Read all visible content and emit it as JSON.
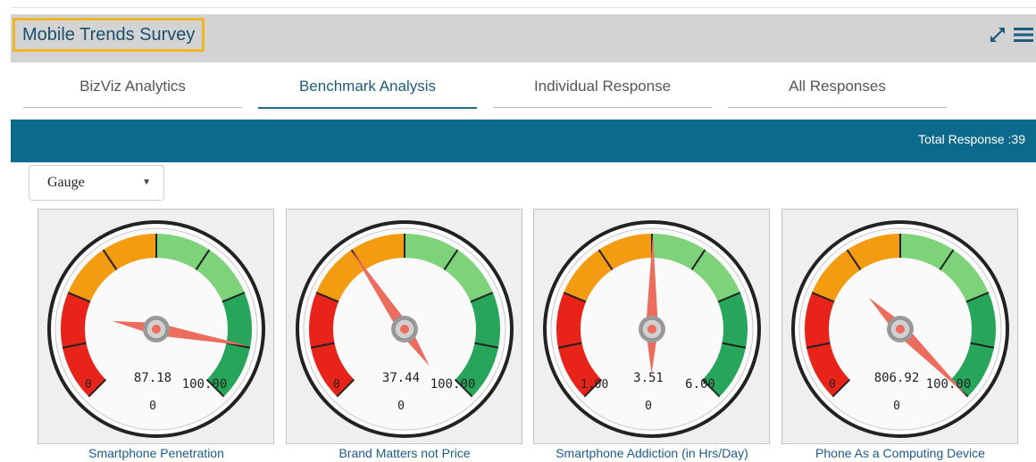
{
  "header": {
    "title": "Mobile Trends Survey",
    "expand_icon": "expand-arrows-icon",
    "menu_icon": "hamburger-menu-icon"
  },
  "tabs": [
    {
      "label": "BizViz Analytics",
      "active": false
    },
    {
      "label": "Benchmark Analysis",
      "active": true
    },
    {
      "label": "Individual Response",
      "active": false
    },
    {
      "label": "All Responses",
      "active": false
    }
  ],
  "banner": {
    "total_response": "Total Response :39"
  },
  "chart_type_select": {
    "value": "Gauge"
  },
  "colors": {
    "header_bg": "#d3d3d3",
    "title_border": "#f0b429",
    "banner_bg": "#0e6a8d",
    "red": "#e8231a",
    "orange": "#f39c12",
    "light_green": "#7ed37a",
    "dark_green": "#27a55a",
    "needle": "#ec6c5e"
  },
  "gauges": [
    {
      "name": "Smartphone Penetration",
      "min": 0,
      "max": 100,
      "value": 87.18,
      "min_label": "0",
      "max_label": "100.00",
      "value_label": "87.18",
      "sub_label": "0"
    },
    {
      "name": "Brand Matters not Price",
      "min": 0,
      "max": 100,
      "value": 37.44,
      "min_label": "0",
      "max_label": "100.00",
      "value_label": "37.44",
      "sub_label": "0"
    },
    {
      "name": "Smartphone Addiction (in Hrs/Day)",
      "min": 1,
      "max": 6,
      "value": 3.51,
      "min_label": "1.00",
      "max_label": "6.00",
      "value_label": "3.51",
      "sub_label": "0"
    },
    {
      "name": "Phone As a Computing Device",
      "min": 0,
      "max": 100,
      "value": 806.92,
      "min_label": "0",
      "max_label": "100.00",
      "value_label": "806.92",
      "sub_label": "0"
    }
  ]
}
